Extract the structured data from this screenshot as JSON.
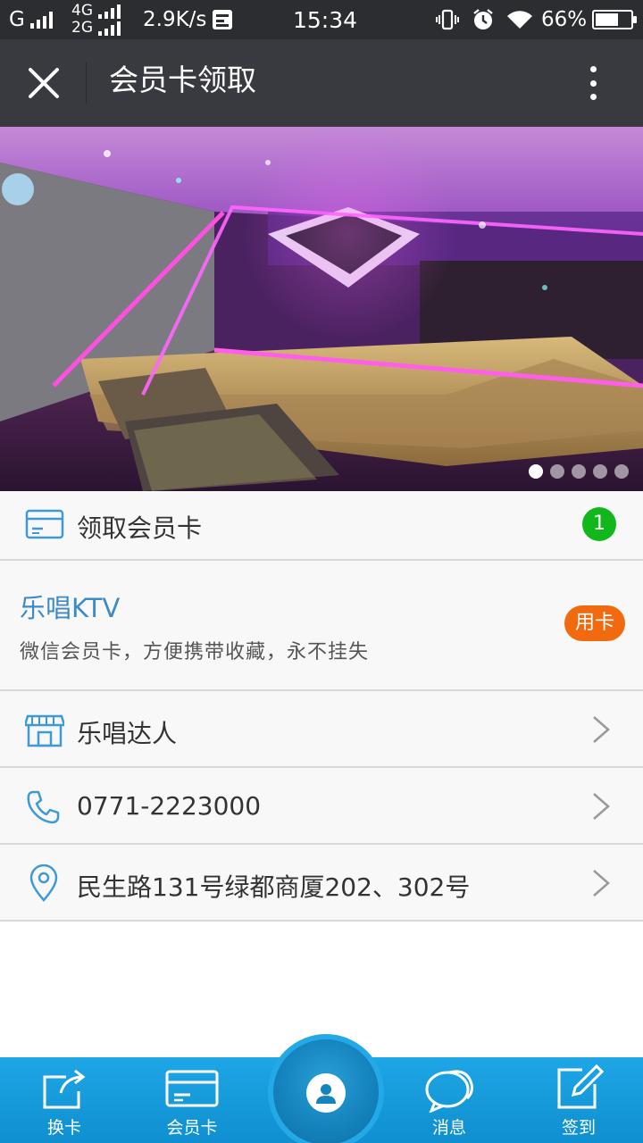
{
  "status_bar": {
    "network1": "G",
    "network2_top": "4G",
    "network2_bottom": "2G",
    "speed": "2.9K/s",
    "time": "15:34",
    "battery_percent": "66%",
    "battery_level": 0.66
  },
  "title_bar": {
    "title": "会员卡领取"
  },
  "banner": {
    "slide_count": 5,
    "active_slide": 1
  },
  "receive_row": {
    "label": "领取会员卡",
    "badge": "1"
  },
  "card": {
    "name": "乐唱KTV",
    "description": "微信会员卡，方便携带收藏，永不挂失",
    "use_button": "用卡"
  },
  "info_rows": {
    "store": "乐唱达人",
    "phone": "0771-2223000",
    "address": "民生路131号绿都商厦202、302号"
  },
  "bottom_nav": {
    "switch": "换卡",
    "card": "会员卡",
    "messages": "消息",
    "checkin": "签到"
  },
  "colors": {
    "accent_blue": "#1ea6e6",
    "badge_green": "#12b71b",
    "button_orange": "#f26a10",
    "card_name_blue": "#3e8ac6"
  }
}
